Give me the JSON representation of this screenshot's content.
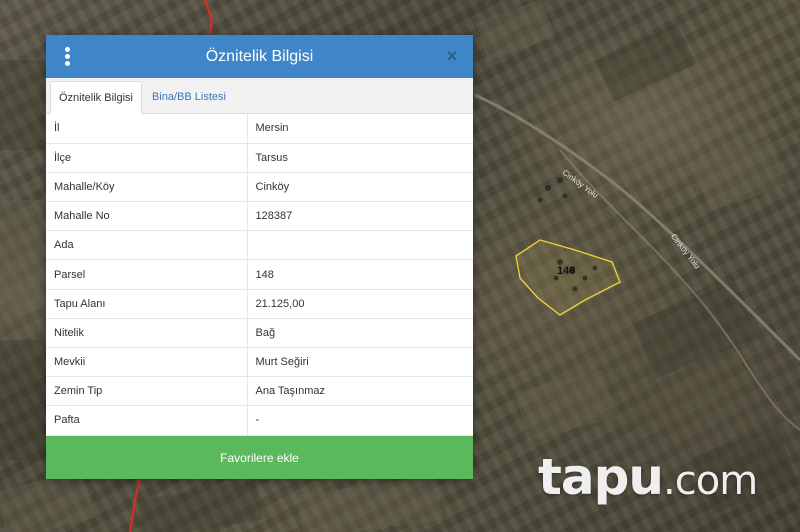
{
  "dialog": {
    "title": "Öznitelik Bilgisi",
    "close_symbol": "×",
    "tabs": [
      {
        "label": "Öznitelik Bilgisi",
        "active": true
      },
      {
        "label": "Bina/BB Listesi",
        "active": false
      }
    ],
    "rows": [
      {
        "key": "İl",
        "value": "Mersin"
      },
      {
        "key": "İlçe",
        "value": "Tarsus"
      },
      {
        "key": "Mahalle/Köy",
        "value": "Cinköy"
      },
      {
        "key": "Mahalle No",
        "value": "128387"
      },
      {
        "key": "Ada",
        "value": ""
      },
      {
        "key": "Parsel",
        "value": "148"
      },
      {
        "key": "Tapu Alanı",
        "value": "21.125,00"
      },
      {
        "key": "Nitelik",
        "value": "Bağ"
      },
      {
        "key": "Mevkii",
        "value": "Murt Seğiri"
      },
      {
        "key": "Zemin Tip",
        "value": "Ana Taşınmaz"
      },
      {
        "key": "Pafta",
        "value": "-"
      }
    ],
    "favorite_button": "Favorilere ekle"
  },
  "map": {
    "parcel_label": "148",
    "parcel_color": "#e8d13a",
    "road_labels": [
      "Cinköy Yolu",
      "Cinköy Yolu"
    ]
  },
  "watermark": {
    "main": "tapu",
    "sub": ".com"
  },
  "colors": {
    "header": "#3f86c8",
    "button": "#5cb85c",
    "tab_link": "#3a78b8",
    "road_red": "#c8322b"
  },
  "icons": {
    "menu": "vertical-dots-icon",
    "close": "close-icon"
  }
}
